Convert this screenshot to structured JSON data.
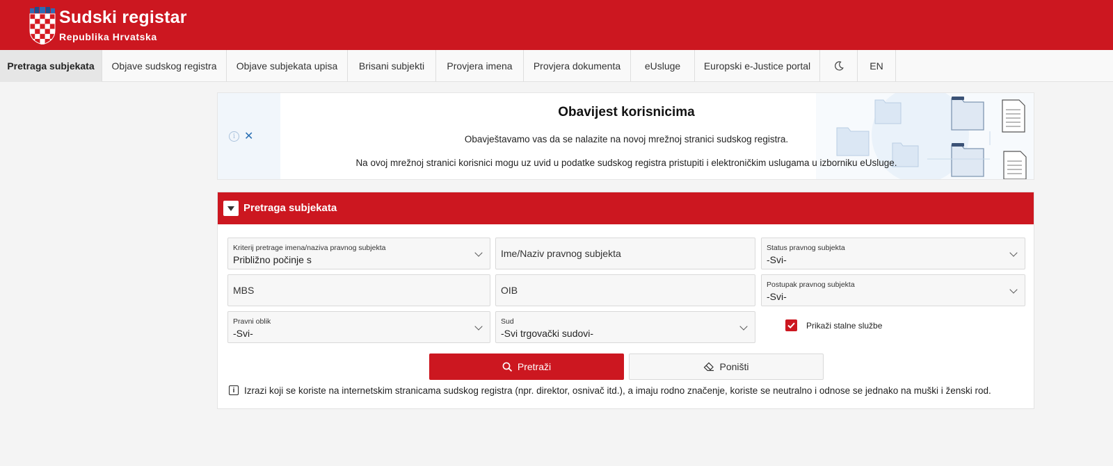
{
  "header": {
    "title": "Sudski registar",
    "subtitle": "Republika Hrvatska",
    "brand_color": "#cc1720"
  },
  "nav": {
    "items": [
      {
        "label": "Pretraga subjekata",
        "active": true
      },
      {
        "label": "Objave sudskog registra"
      },
      {
        "label": "Objave subjekata upisa"
      },
      {
        "label": "Brisani subjekti"
      },
      {
        "label": "Provjera imena"
      },
      {
        "label": "Provjera dokumenta"
      },
      {
        "label": "eUsluge"
      },
      {
        "label": "Europski e-Justice portal"
      },
      {
        "label": "",
        "icon": "moon-icon"
      },
      {
        "label": "EN"
      }
    ]
  },
  "notice": {
    "title": "Obavijest korisnicima",
    "line1": "Obavještavamo vas da se nalazite na novoj mrežnoj stranici sudskog registra.",
    "line2": "Na ovoj mrežnoj stranici korisnici mogu uz uvid u podatke sudskog registra pristupiti i elektroničkim uslugama u izborniku eUsluge.",
    "icons": [
      "info-icon",
      "close-icon"
    ]
  },
  "search_panel": {
    "title": "Pretraga subjekata",
    "fields": {
      "criteria": {
        "label": "Kriterij pretrage imena/naziva pravnog subjekta",
        "value": "Približno počinje s"
      },
      "name": {
        "placeholder": "Ime/Naziv pravnog subjekta"
      },
      "status": {
        "label": "Status pravnog subjekta",
        "value": "-Svi-"
      },
      "mbs": {
        "placeholder": "MBS"
      },
      "oib": {
        "placeholder": "OIB"
      },
      "procedure": {
        "label": "Postupak pravnog subjekta",
        "value": "-Svi-"
      },
      "legal_form": {
        "label": "Pravni oblik",
        "value": "-Svi-"
      },
      "court": {
        "label": "Sud",
        "value": "-Svi trgovački sudovi-"
      }
    },
    "checkbox": {
      "label": "Prikaži stalne službe",
      "checked": true
    },
    "search_button": "Pretraži",
    "reset_button": "Poništi",
    "note": "Izrazi koji se koriste na internetskim stranicama sudskog registra (npr. direktor, osnivač itd.), a imaju rodno značenje, koriste se neutralno i odnose se jednako na muški i ženski rod."
  }
}
